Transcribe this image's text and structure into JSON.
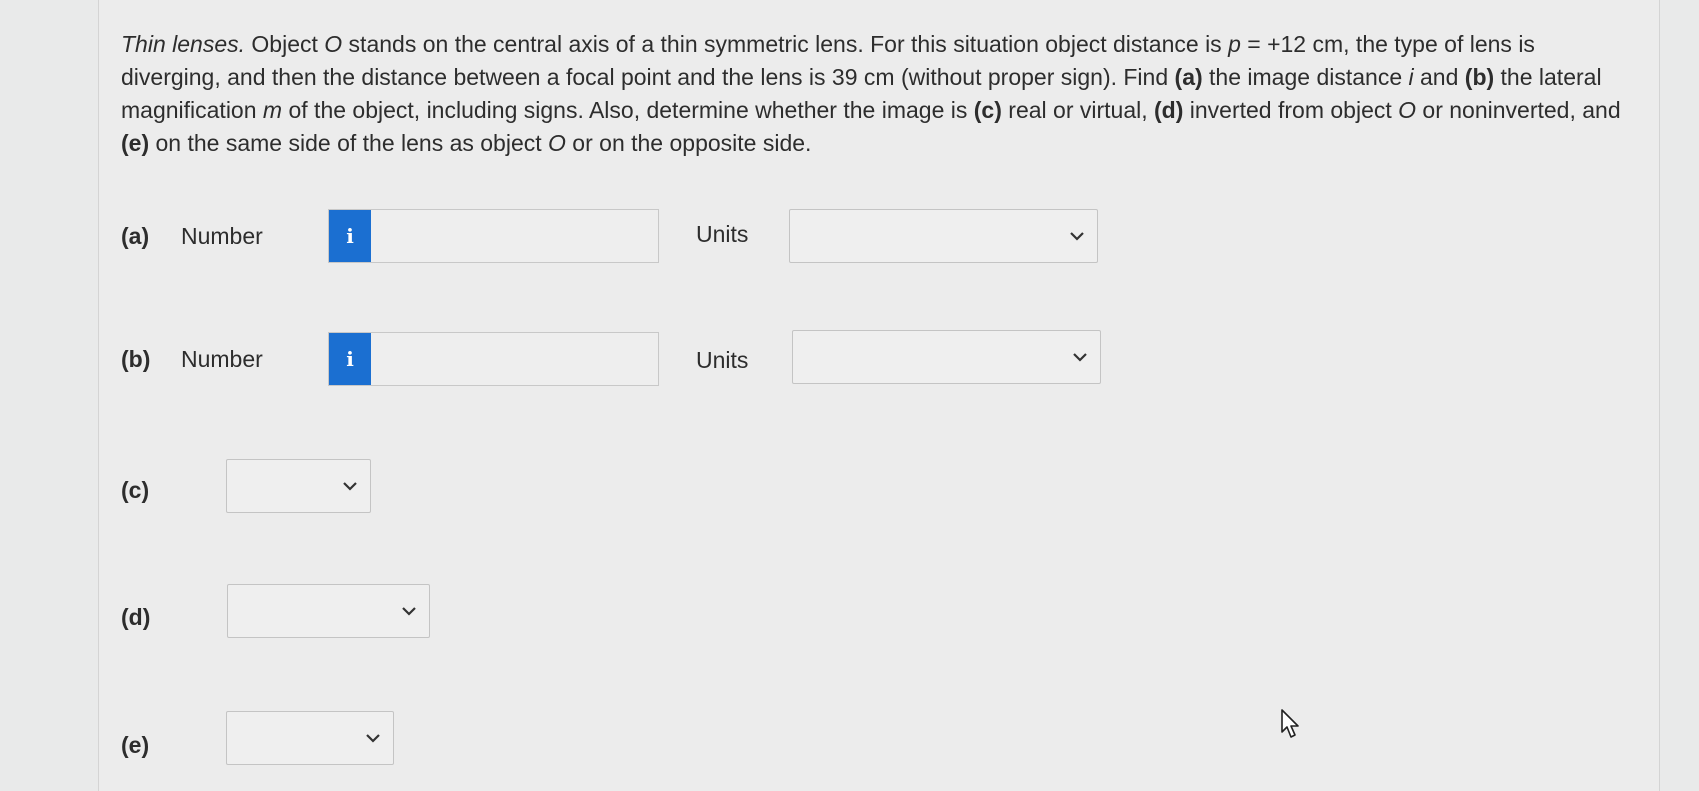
{
  "question": {
    "lead_italic": "Thin lenses.",
    "seg1": " Object ",
    "obj1": "O",
    "seg2": " stands on the central axis of a thin symmetric lens. For this situation object distance is ",
    "p_var": "p",
    "seg3": " = +12 cm, the type of lens is diverging, and then the distance between a focal point and the lens is 39 cm (without proper sign). Find ",
    "a_tag": "(a)",
    "seg4": " the image distance ",
    "i_var": "i",
    "seg5": " and ",
    "b_tag": "(b)",
    "seg6": " the lateral magnification ",
    "m_var": "m",
    "seg7": " of the object, including signs. Also, determine whether the image is ",
    "c_tag": "(c)",
    "seg8": " real or virtual, ",
    "d_tag": "(d)",
    "seg9": " inverted from object ",
    "obj2": "O",
    "seg10": " or noninverted, and ",
    "e_tag": "(e)",
    "seg11": " on the same side of the lens as object ",
    "obj3": "O",
    "seg12": " or on the opposite side."
  },
  "parts": {
    "a": {
      "label": "(a)",
      "number_label": "Number",
      "units_label": "Units",
      "info_glyph": "i",
      "value": "",
      "units_value": ""
    },
    "b": {
      "label": "(b)",
      "number_label": "Number",
      "units_label": "Units",
      "info_glyph": "i",
      "value": "",
      "units_value": ""
    },
    "c": {
      "label": "(c)",
      "value": ""
    },
    "d": {
      "label": "(d)",
      "value": ""
    },
    "e": {
      "label": "(e)",
      "value": ""
    }
  },
  "colors": {
    "info_button": "#1b6fd1",
    "background": "#ececec"
  },
  "icons": {
    "info": "info-icon",
    "dropdown": "chevron-down-icon",
    "cursor": "mouse-pointer-icon"
  }
}
